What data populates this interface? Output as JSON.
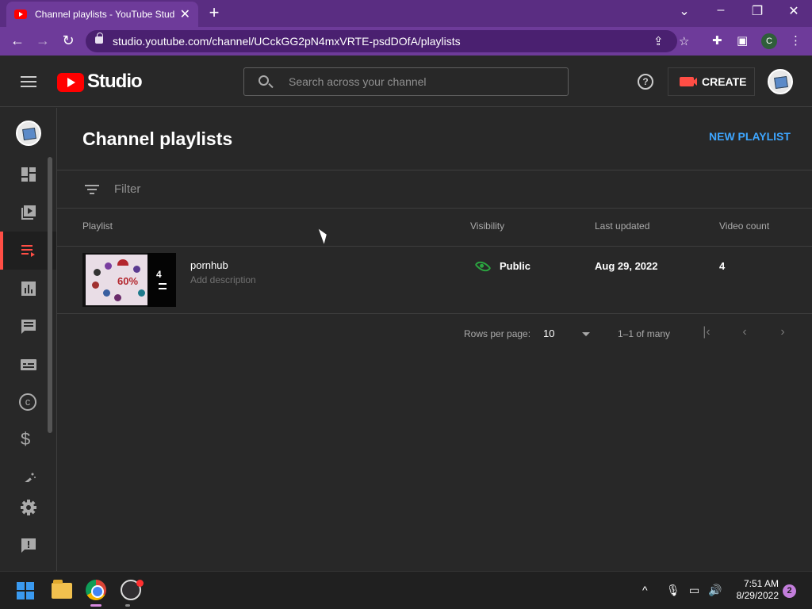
{
  "browser": {
    "tab_title": "Channel playlists - YouTube Stud",
    "tab_close": "✕",
    "new_tab": "+",
    "url": "studio.youtube.com/channel/UCckGG2pN4mxVRTE-psdDOfA/playlists",
    "profile_initial": "C"
  },
  "header": {
    "logo_text": "Studio",
    "search_placeholder": "Search across your channel",
    "help_glyph": "?",
    "create_label": "CREATE"
  },
  "sidebar": {
    "items": [
      {
        "name": "dashboard",
        "icon": "dashboard-icon"
      },
      {
        "name": "content",
        "icon": "content-icon"
      },
      {
        "name": "playlists",
        "icon": "playlists-icon",
        "active": true
      },
      {
        "name": "analytics",
        "icon": "analytics-icon"
      },
      {
        "name": "comments",
        "icon": "comments-icon"
      },
      {
        "name": "subtitles",
        "icon": "subtitles-icon"
      },
      {
        "name": "copyright",
        "icon": "copyright-icon"
      },
      {
        "name": "earn",
        "icon": "dollar-icon"
      },
      {
        "name": "customization",
        "icon": "magic-wand-icon"
      },
      {
        "name": "settings",
        "icon": "gear-icon"
      },
      {
        "name": "feedback",
        "icon": "feedback-icon"
      }
    ],
    "copyright_glyph": "©",
    "earn_glyph": "$"
  },
  "main": {
    "title": "Channel playlists",
    "new_playlist_label": "NEW PLAYLIST",
    "filter_label": "Filter",
    "columns": [
      "Playlist",
      "Visibility",
      "Last updated",
      "Video count"
    ],
    "rows": [
      {
        "title": "pornhub",
        "description": "Add description",
        "thumb_count": "4",
        "thumb_text": "60%",
        "visibility": "Public",
        "last_updated": "Aug 29, 2022",
        "video_count": "4"
      }
    ],
    "pager": {
      "rows_per_page_label": "Rows per page:",
      "rows_per_page": "10",
      "range": "1–1 of many"
    }
  },
  "taskbar": {
    "time": "7:51 AM",
    "date": "8/29/2022",
    "notifications": "2"
  },
  "colors": {
    "accent_blue": "#3ea6ff",
    "brand_red": "#ff0000",
    "public_green": "#2ba640",
    "browser_purple": "#6e3b9a"
  }
}
